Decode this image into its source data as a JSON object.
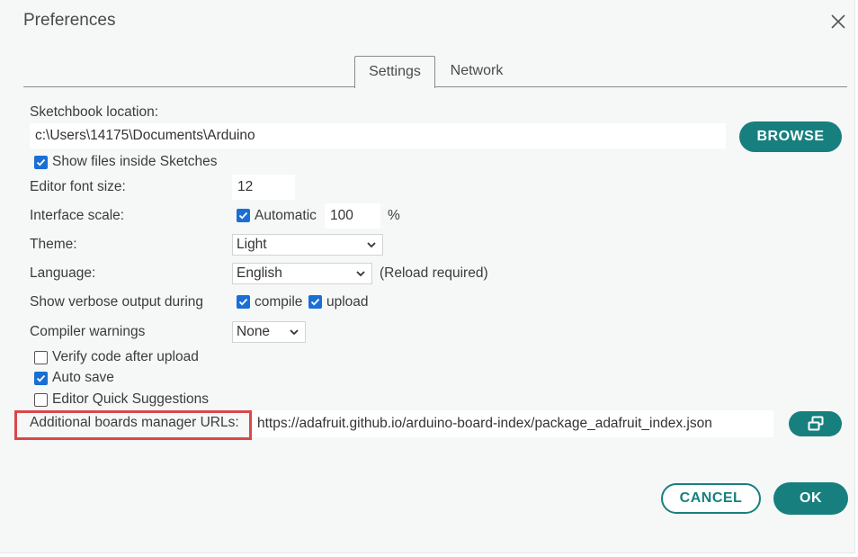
{
  "dialog": {
    "title": "Preferences"
  },
  "tabs": [
    {
      "label": "Settings",
      "active": true
    },
    {
      "label": "Network",
      "active": false
    }
  ],
  "settings": {
    "sketchbook_label": "Sketchbook location:",
    "sketchbook_path": "c:\\Users\\14175\\Documents\\Arduino",
    "browse_label": "BROWSE",
    "show_files_label": "Show files inside Sketches",
    "show_files_checked": true,
    "font_size_label": "Editor font size:",
    "font_size_value": "12",
    "scale_label": "Interface scale:",
    "scale_automatic_label": "Automatic",
    "scale_automatic_checked": true,
    "scale_value": "100",
    "scale_unit": "%",
    "theme_label": "Theme:",
    "theme_value": "Light",
    "language_label": "Language:",
    "language_value": "English",
    "language_note": "(Reload required)",
    "verbose_label": "Show verbose output during",
    "verbose_compile_label": "compile",
    "verbose_compile_checked": true,
    "verbose_upload_label": "upload",
    "verbose_upload_checked": true,
    "warnings_label": "Compiler warnings",
    "warnings_value": "None",
    "verify_label": "Verify code after upload",
    "verify_checked": false,
    "autosave_label": "Auto save",
    "autosave_checked": true,
    "quick_suggestions_label": "Editor Quick Suggestions",
    "quick_suggestions_checked": false,
    "boards_url_label": "Additional boards manager URLs:",
    "boards_url_value": "https://adafruit.github.io/arduino-board-index/package_adafruit_index.json"
  },
  "footer": {
    "cancel_label": "CANCEL",
    "ok_label": "OK"
  },
  "colors": {
    "accent": "#17807f",
    "checkbox": "#1a6fd4",
    "highlight": "#d9484c"
  },
  "icons": {
    "close": "close-icon",
    "open_window": "open-window-icon",
    "chevron": "chevron-down-icon",
    "check": "checkmark-icon"
  }
}
